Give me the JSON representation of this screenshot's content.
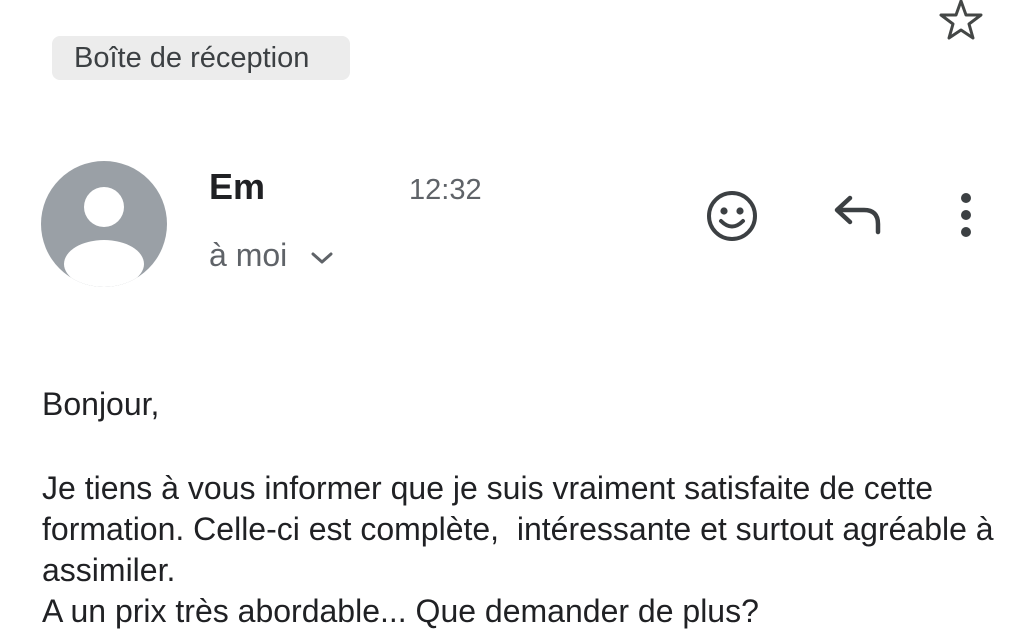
{
  "header": {
    "label_chip": "Boîte de réception",
    "star_icon": "star-outline-icon"
  },
  "message": {
    "sender_name": "Em",
    "time": "12:32",
    "recipient": "à moi",
    "avatar_icon": "person-avatar-icon",
    "actions": {
      "emoji_icon": "add-reaction-icon",
      "reply_icon": "reply-icon",
      "more_icon": "more-vertical-icon"
    },
    "body": {
      "greeting": "Bonjour,",
      "paragraph": "Je tiens à vous informer que je suis vraiment satisfaite de cette formation. Celle-ci est complète,  intéressante et surtout agréable à assimiler.",
      "closing": "A un prix très abordable... Que demander de plus?"
    }
  },
  "colors": {
    "avatar_bg": "#9aa0a6",
    "chip_bg": "#ececec",
    "text": "#202124",
    "secondary_text": "#5f6368"
  }
}
